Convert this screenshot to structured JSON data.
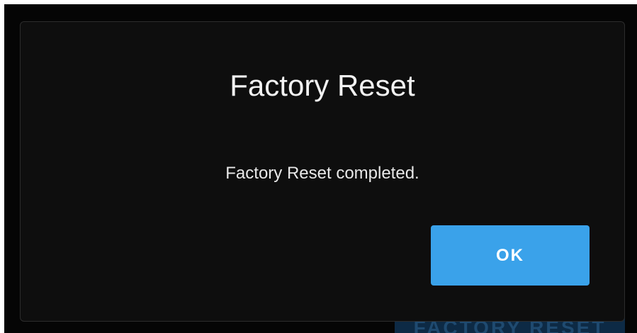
{
  "background": {
    "button_label": "FACTORY RESET",
    "button_color": "#0d2a45"
  },
  "dialog": {
    "title": "Factory Reset",
    "message": "Factory Reset completed.",
    "ok_label": "OK",
    "accent_color": "#3aa2ea",
    "background_color": "#0e0e0e"
  }
}
